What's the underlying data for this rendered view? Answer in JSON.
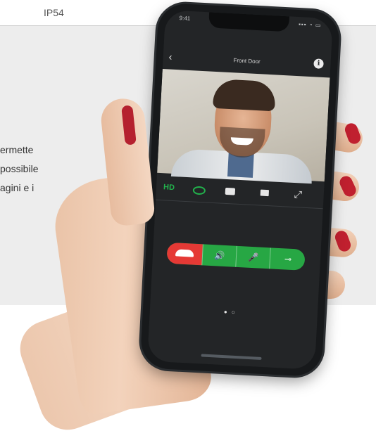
{
  "spec_row": {
    "value": "IP54"
  },
  "description": {
    "lines": [
      "ermette",
      "possibile",
      "agini e i"
    ]
  },
  "phone": {
    "status": {
      "time": "9:41",
      "icons": "▪▪▪ ◔ ▭"
    },
    "app": {
      "back_glyph": "‹",
      "title": "Front Door",
      "info_glyph": "i"
    },
    "controls": {
      "hd_label": "HD",
      "expand_glyph": "⤢"
    },
    "call": {
      "speaker_glyph": "🔊",
      "mic_glyph": "🎤",
      "key_glyph": "⊸"
    },
    "pager": "● ○"
  },
  "colors": {
    "accent_green": "#27a744",
    "hangup_red": "#e53935",
    "panel_grey": "#ededed"
  }
}
